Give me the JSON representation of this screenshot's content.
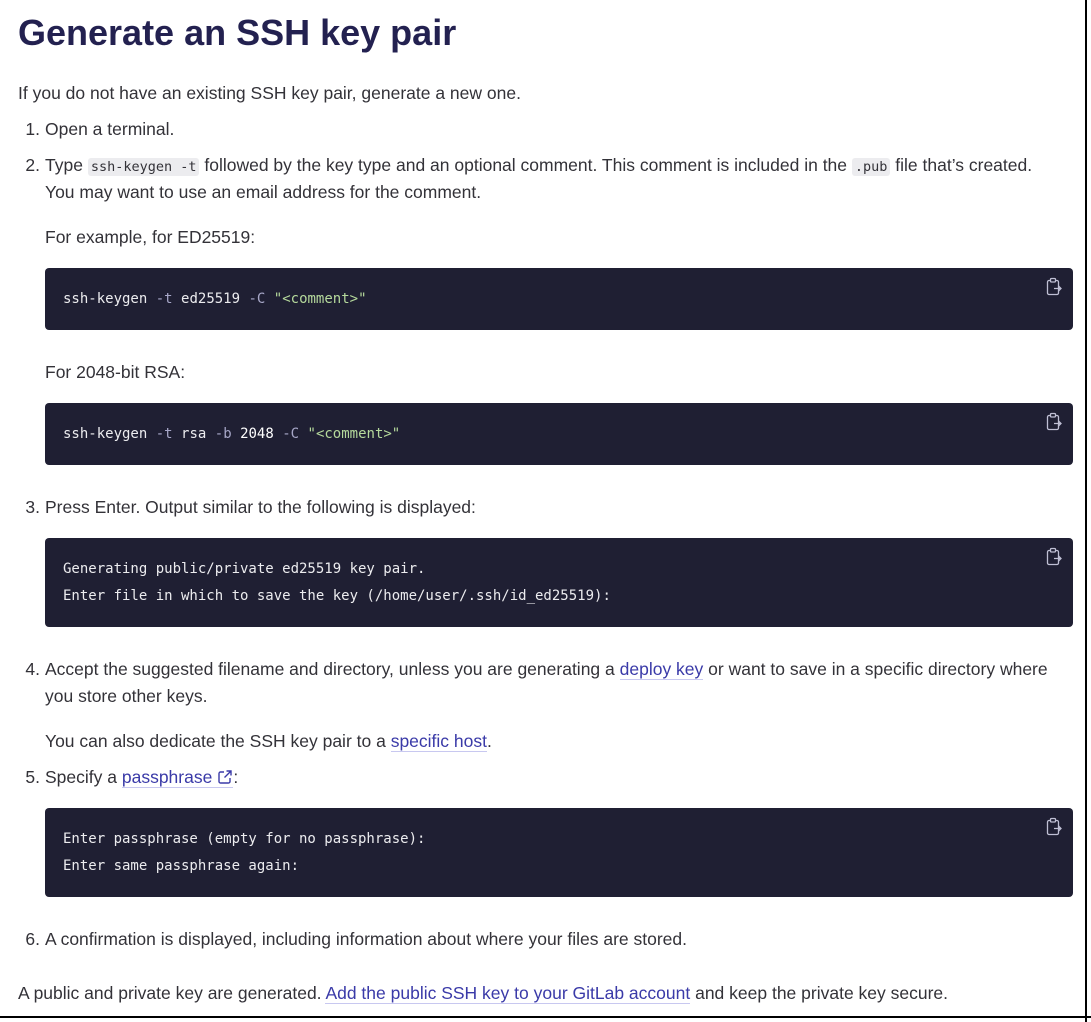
{
  "heading": "Generate an SSH key pair",
  "intro": "If you do not have an existing SSH key pair, generate a new one.",
  "steps": {
    "s1": {
      "num": "1.",
      "text": "Open a terminal."
    },
    "s2": {
      "num": "2.",
      "text_a": "Type ",
      "code_a": "ssh-keygen -t",
      "text_b": " followed by the key type and an optional comment. This comment is included in the ",
      "code_b": ".pub",
      "text_c": " file that’s created.",
      "line2": "You may want to use an email address for the comment.",
      "example_ed": "For example, for ED25519:",
      "example_rsa": "For 2048-bit RSA:"
    },
    "s3": {
      "num": "3.",
      "text": "Press Enter. Output similar to the following is displayed:"
    },
    "s4": {
      "num": "4.",
      "text_a": "Accept the suggested filename and directory, unless you are generating a ",
      "link_deploy": "deploy key",
      "text_b": " or want to save in a specific directory where",
      "line2": "you store other keys.",
      "host_a": "You can also dedicate the SSH key pair to a ",
      "link_host": "specific host",
      "host_b": "."
    },
    "s5": {
      "num": "5.",
      "text_a": "Specify a ",
      "link_passphrase": "passphrase",
      "text_b": ":"
    },
    "s6": {
      "num": "6.",
      "text": "A confirmation is displayed, including information about where your files are stored."
    }
  },
  "code": {
    "ed": {
      "cmd": "ssh-keygen",
      "f1": "-t",
      "type": "ed25519",
      "f2": "-C",
      "comment": "\"<comment>\""
    },
    "rsa": {
      "cmd": "ssh-keygen",
      "f1": "-t",
      "type": "rsa",
      "f2": "-b",
      "bits": "2048",
      "f3": "-C",
      "comment": "\"<comment>\""
    },
    "output": [
      "Generating public/private ed25519 key pair.",
      "Enter file in which to save the key (/home/user/.ssh/id_ed25519):"
    ],
    "passphrase": [
      "Enter passphrase (empty for no passphrase):",
      "Enter same passphrase again:"
    ]
  },
  "outro": {
    "text_a": "A public and private key are generated. ",
    "link": "Add the public SSH key to your GitLab account",
    "text_b": " and keep the private key secure."
  },
  "icons": {
    "copy": "clipboard-copy-icon",
    "external": "external-link-icon"
  },
  "colors": {
    "heading": "#232150",
    "link": "#3a3aa8",
    "code_bg": "#1f1f33"
  }
}
